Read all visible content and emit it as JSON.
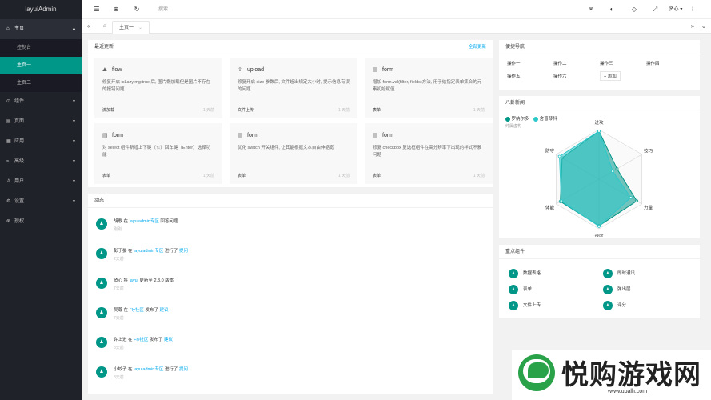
{
  "app": {
    "title": "layuiAdmin"
  },
  "sidebar": {
    "items": [
      {
        "icon": "home-icon",
        "glyph": "⌂",
        "label": "主页",
        "open": true
      },
      {
        "icon": "component-icon",
        "glyph": "⊙",
        "label": "组件"
      },
      {
        "icon": "page-icon",
        "glyph": "▤",
        "label": "页面"
      },
      {
        "icon": "app-icon",
        "glyph": "▦",
        "label": "应用"
      },
      {
        "icon": "senior-icon",
        "glyph": "≈",
        "label": "高级"
      },
      {
        "icon": "user-icon",
        "glyph": "♙",
        "label": "用户"
      },
      {
        "icon": "settings-icon",
        "glyph": "⚙",
        "label": "设置"
      },
      {
        "icon": "auth-icon",
        "glyph": "⊗",
        "label": "授权"
      }
    ],
    "home_sub": [
      "控制台",
      "主页一",
      "主页二"
    ]
  },
  "header": {
    "search_placeholder": "搜索",
    "user_name": "贤心",
    "icons": [
      "menu-icon",
      "globe-icon",
      "refresh-icon",
      "message-icon",
      "theme-icon",
      "note-icon",
      "fullscreen-icon"
    ]
  },
  "tabs": {
    "current": "主页一"
  },
  "updates": {
    "title": "最近更新",
    "more": "全部更新",
    "items": [
      {
        "title": "flow",
        "desc": "修复开启 isLazyimg:true 后, 图片懒加载但是图片不存在的报错问题",
        "tag": "流加载",
        "time": "1 天前"
      },
      {
        "title": "upload",
        "desc": "修复开启 size 参数后, 文件超出规定大小时, 提示信息有误的问题",
        "tag": "文件上传",
        "time": "1 天前"
      },
      {
        "title": "form",
        "desc": "增加 form.val(filter, fields)方法, 用于给指定表单集合的元素初始赋值",
        "tag": "表单",
        "time": "1 天前"
      },
      {
        "title": "form",
        "desc": "对 select 组件新增上下键（↑↓）回车键（Enter）选择功能",
        "tag": "表单",
        "time": "1 天前"
      },
      {
        "title": "form",
        "desc": "优化 switch 开关组件, 让其能根据文本自由伸缩宽",
        "tag": "表单",
        "time": "1 天前"
      },
      {
        "title": "form",
        "desc": "修复 checkbox 复选框组件在高分辨率下出现的样式不雅问题",
        "tag": "表单",
        "time": "1 天前"
      }
    ]
  },
  "activity": {
    "title": "动态",
    "items": [
      {
        "user": "胡歌",
        "mid": " 在 ",
        "link1": "layuiadmin专区",
        "action": " 回答问题",
        "link2": "",
        "time": "刚刚"
      },
      {
        "user": "彭于晏",
        "mid": " 在 ",
        "link1": "layuiadmin专区",
        "action": " 进行了 ",
        "link2": "提问",
        "time": "2天前"
      },
      {
        "user": "贤心",
        "mid": " 将 ",
        "link1": "layui",
        "action": " 更新至 2.3.0 版本",
        "link2": "",
        "time": "7天前"
      },
      {
        "user": "吴尊",
        "mid": " 在 ",
        "link1": "Fly社区",
        "action": " 发布了 ",
        "link2": "建议",
        "time": "7天前"
      },
      {
        "user": "许上进",
        "mid": " 在 ",
        "link1": "Fly社区",
        "action": " 发布了 ",
        "link2": "建议",
        "time": "8天前"
      },
      {
        "user": "小蚊子",
        "mid": " 在 ",
        "link1": "layuiadmin专区",
        "action": " 进行了 ",
        "link2": "提问",
        "time": "8天前"
      }
    ]
  },
  "quick": {
    "title": "便捷导航",
    "items": [
      "操作一",
      "操作二",
      "操作三",
      "操作四",
      "操作五",
      "操作六"
    ],
    "add": "+ 添加"
  },
  "radar": {
    "title": "八卦新闻",
    "legend": [
      "罗纳尔多",
      "舍普琴科"
    ],
    "subtitle": "纯属虚构",
    "axes": [
      "进攻",
      "防守",
      "体能",
      "速度",
      "力量",
      "技巧"
    ],
    "colors": [
      "#009688",
      "#2ec7c9"
    ]
  },
  "chart_data": {
    "type": "radar",
    "title": "八卦新闻",
    "axes": [
      "进攻",
      "技巧",
      "力量",
      "速度",
      "体能",
      "防守"
    ],
    "max": 100,
    "series": [
      {
        "name": "罗纳尔多",
        "values": [
          97,
          42,
          88,
          94,
          90,
          86
        ]
      },
      {
        "name": "舍普琴科",
        "values": [
          97,
          32,
          74,
          95,
          88,
          92
        ]
      }
    ]
  },
  "keys": {
    "title": "重点组件",
    "items": [
      "数据表格",
      "即时通讯",
      "表单",
      "弹出层",
      "文件上传",
      "评分"
    ]
  },
  "watermark": {
    "text": "悦购游戏网",
    "url": "www.ubalh.com"
  }
}
